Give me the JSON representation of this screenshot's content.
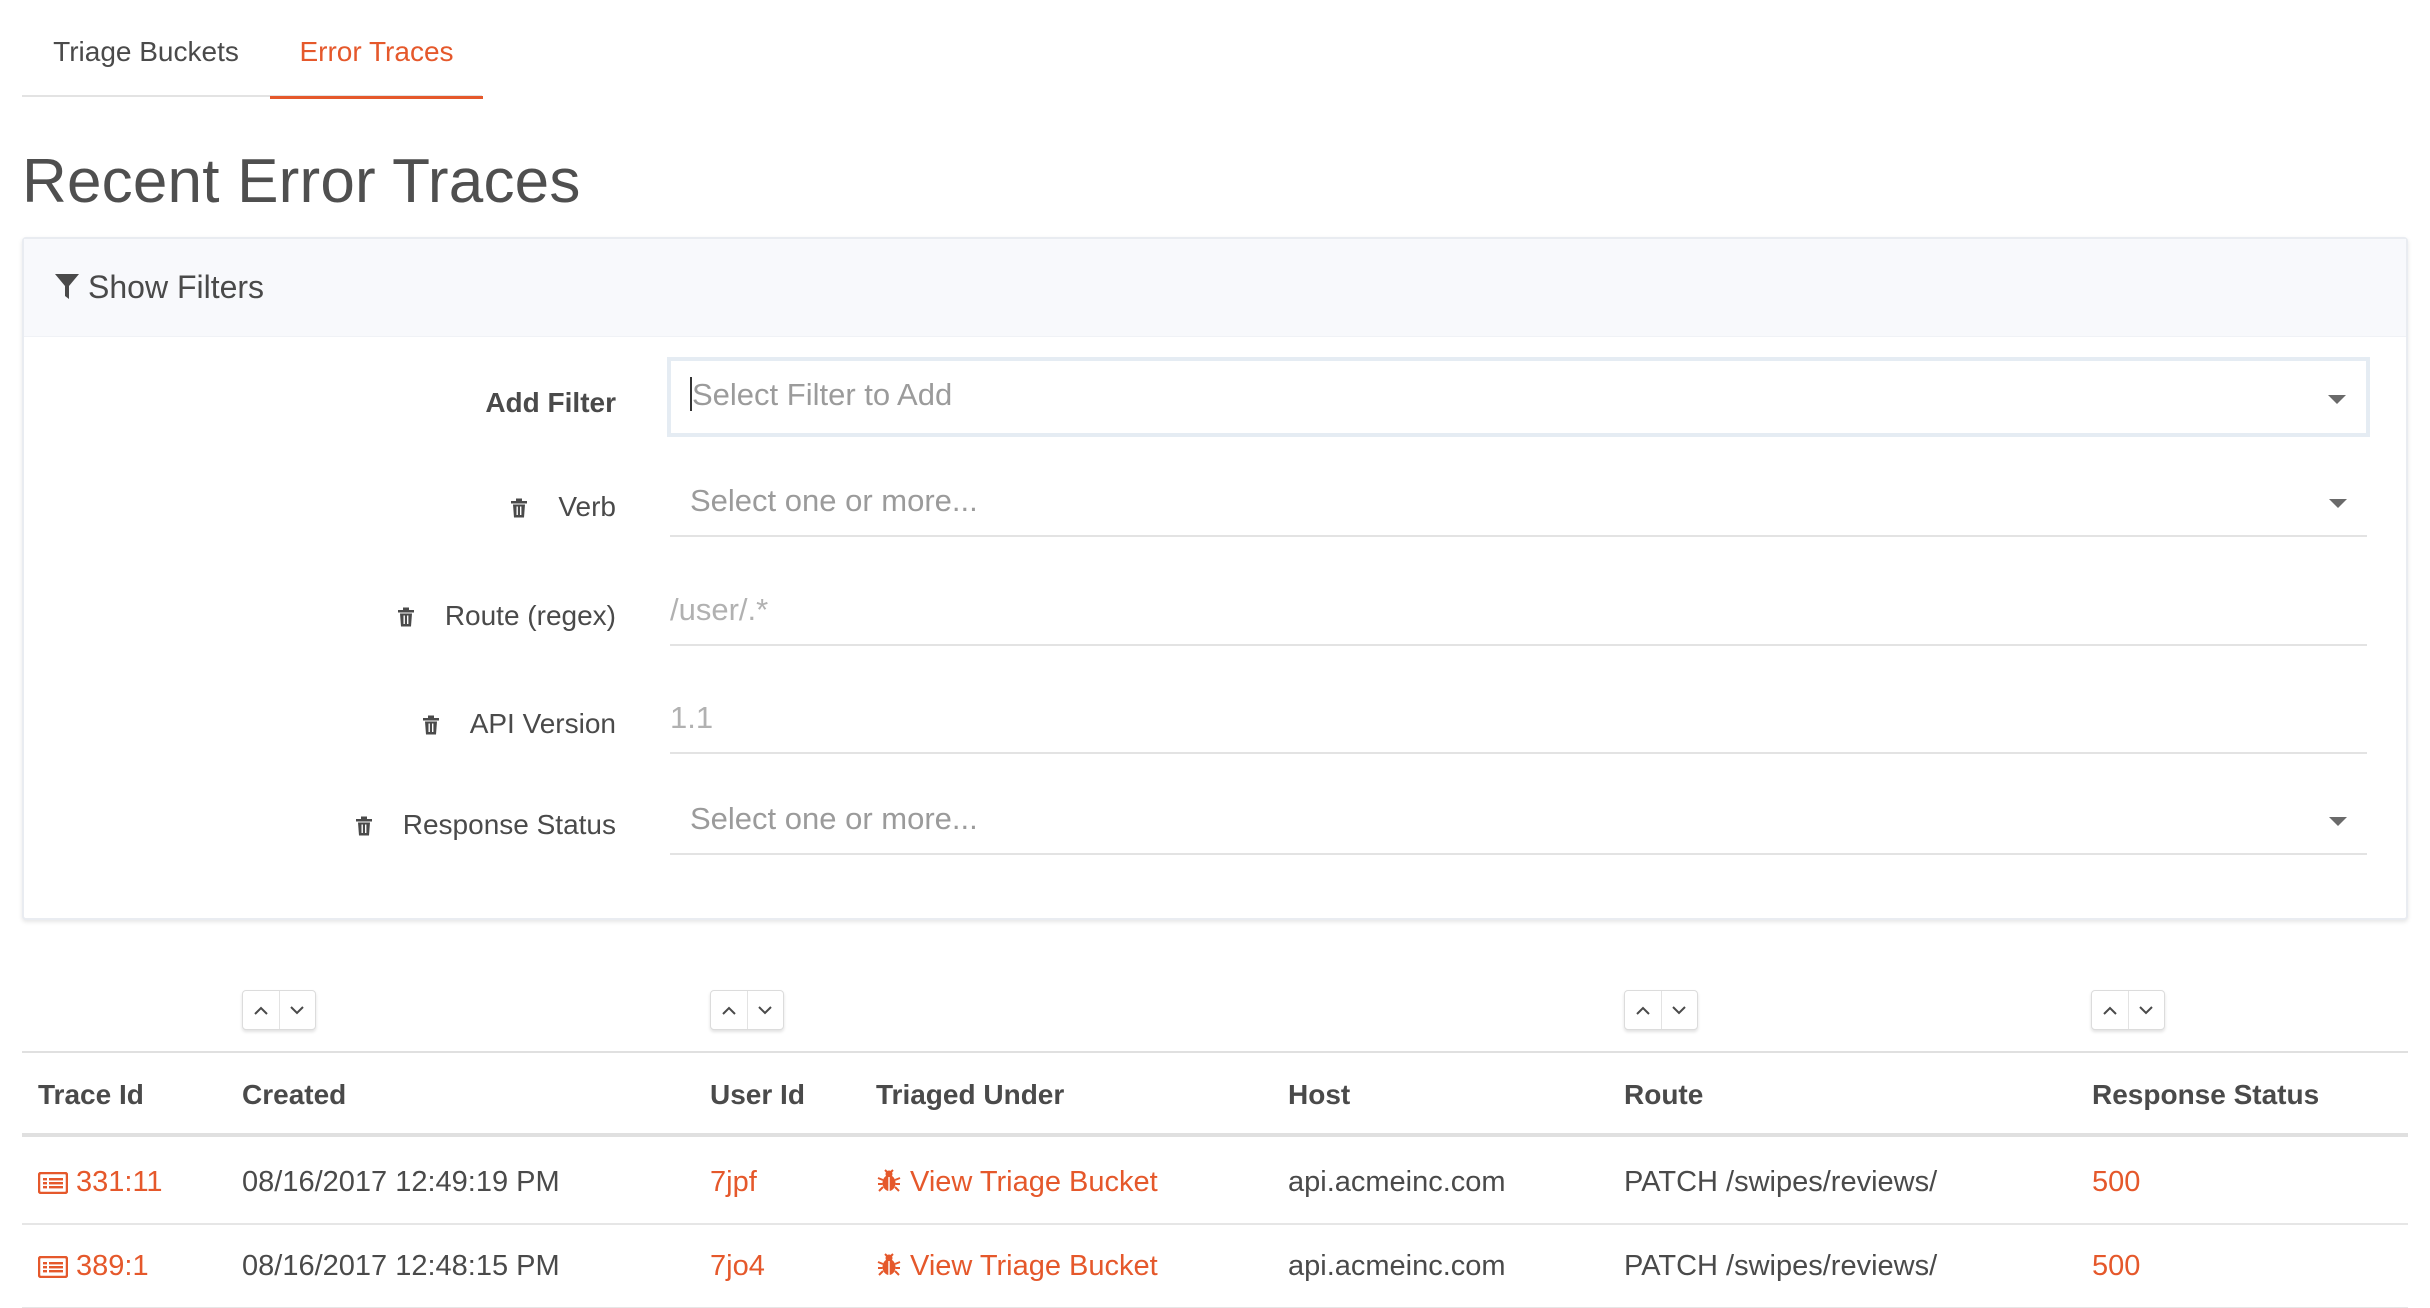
{
  "tabs": [
    {
      "label": "Triage Buckets",
      "active": false
    },
    {
      "label": "Error Traces",
      "active": true
    }
  ],
  "page_title": "Recent Error Traces",
  "filters": {
    "toggle_label": "Show Filters",
    "add_filter": {
      "label": "Add Filter",
      "placeholder": "Select Filter to Add"
    },
    "verb": {
      "label": "Verb",
      "placeholder": "Select one or more..."
    },
    "route": {
      "label": "Route (regex)",
      "placeholder": "/user/.*"
    },
    "api_version": {
      "label": "API Version",
      "placeholder": "1.1"
    },
    "response_status": {
      "label": "Response Status",
      "placeholder": "Select one or more..."
    }
  },
  "table": {
    "columns": [
      "Trace Id",
      "Created",
      "User Id",
      "Triaged Under",
      "Host",
      "Route",
      "Response Status"
    ],
    "rows": [
      {
        "trace_id": "331:11",
        "created": "08/16/2017 12:49:19 PM",
        "user_id": "7jpf",
        "triaged_under": "View Triage Bucket",
        "host": "api.acmeinc.com",
        "route": "PATCH /swipes/reviews/",
        "status": "500"
      },
      {
        "trace_id": "389:1",
        "created": "08/16/2017 12:48:15 PM",
        "user_id": "7jo4",
        "triaged_under": "View Triage Bucket",
        "host": "api.acmeinc.com",
        "route": "PATCH /swipes/reviews/",
        "status": "500"
      }
    ]
  },
  "colors": {
    "accent": "#e5582b",
    "text": "#4a4a4a",
    "muted": "#9b9b9b",
    "border": "#e3e3e3"
  },
  "icons": [
    "funnel-icon",
    "trash-icon",
    "chevron-down-icon",
    "sort-asc-icon",
    "sort-desc-icon",
    "list-icon",
    "bug-icon"
  ]
}
